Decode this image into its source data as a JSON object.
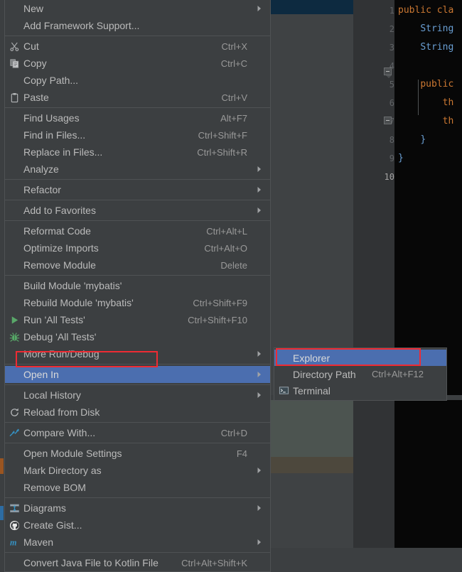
{
  "app": {
    "theme": "IntelliJ IDEA Darcula",
    "accent_highlight": "#4b6eaf",
    "annotation_color": "#ee2b33",
    "menu_bg": "#3c3f41",
    "menu_text": "#bbbbbb"
  },
  "editor": {
    "gutter_line_numbers": [
      "1",
      "2",
      "3",
      "4",
      "5",
      "6",
      "7",
      "8",
      "9",
      "10"
    ],
    "current_line": "10",
    "code_lines": [
      {
        "num": "1",
        "tokens": [
          {
            "t": "public cla",
            "c": "kw"
          }
        ]
      },
      {
        "num": "2",
        "tokens": [
          {
            "t": "    ",
            "c": "plain"
          },
          {
            "t": "String",
            "c": "type"
          }
        ]
      },
      {
        "num": "3",
        "tokens": [
          {
            "t": "    ",
            "c": "plain"
          },
          {
            "t": "String",
            "c": "type"
          }
        ]
      },
      {
        "num": "4",
        "tokens": []
      },
      {
        "num": "5",
        "tokens": [
          {
            "t": "    ",
            "c": "plain"
          },
          {
            "t": "public",
            "c": "kw"
          }
        ]
      },
      {
        "num": "6",
        "tokens": [
          {
            "t": "        ",
            "c": "plain"
          },
          {
            "t": "th",
            "c": "kw"
          }
        ]
      },
      {
        "num": "7",
        "tokens": [
          {
            "t": "        ",
            "c": "plain"
          },
          {
            "t": "th",
            "c": "kw"
          }
        ]
      },
      {
        "num": "8",
        "tokens": [
          {
            "t": "    ",
            "c": "plain"
          },
          {
            "t": "}",
            "c": "brace"
          }
        ]
      },
      {
        "num": "9",
        "tokens": [
          {
            "t": "}",
            "c": "brace"
          }
        ]
      },
      {
        "num": "10",
        "tokens": []
      }
    ]
  },
  "context_menu": {
    "name": "project-view-context-menu",
    "groups": [
      {
        "items": [
          {
            "label": "New",
            "shortcut": "",
            "icon": "",
            "submenu": true
          },
          {
            "label": "Add Framework Support...",
            "shortcut": "",
            "icon": "",
            "submenu": false
          }
        ]
      },
      {
        "items": [
          {
            "label": "Cut",
            "shortcut": "Ctrl+X",
            "icon": "scissors-icon",
            "submenu": false
          },
          {
            "label": "Copy",
            "shortcut": "Ctrl+C",
            "icon": "copy-icon",
            "submenu": false
          },
          {
            "label": "Copy Path...",
            "shortcut": "",
            "icon": "",
            "submenu": false
          },
          {
            "label": "Paste",
            "shortcut": "Ctrl+V",
            "icon": "clipboard-icon",
            "submenu": false
          }
        ]
      },
      {
        "items": [
          {
            "label": "Find Usages",
            "shortcut": "Alt+F7",
            "icon": "",
            "submenu": false
          },
          {
            "label": "Find in Files...",
            "shortcut": "Ctrl+Shift+F",
            "icon": "",
            "submenu": false
          },
          {
            "label": "Replace in Files...",
            "shortcut": "Ctrl+Shift+R",
            "icon": "",
            "submenu": false
          },
          {
            "label": "Analyze",
            "shortcut": "",
            "icon": "",
            "submenu": true
          }
        ]
      },
      {
        "items": [
          {
            "label": "Refactor",
            "shortcut": "",
            "icon": "",
            "submenu": true
          }
        ]
      },
      {
        "items": [
          {
            "label": "Add to Favorites",
            "shortcut": "",
            "icon": "",
            "submenu": true
          }
        ]
      },
      {
        "items": [
          {
            "label": "Reformat Code",
            "shortcut": "Ctrl+Alt+L",
            "icon": "",
            "submenu": false
          },
          {
            "label": "Optimize Imports",
            "shortcut": "Ctrl+Alt+O",
            "icon": "",
            "submenu": false
          },
          {
            "label": "Remove Module",
            "shortcut": "Delete",
            "icon": "",
            "submenu": false
          }
        ]
      },
      {
        "items": [
          {
            "label": "Build Module 'mybatis'",
            "shortcut": "",
            "icon": "",
            "submenu": false
          },
          {
            "label": "Rebuild Module 'mybatis'",
            "shortcut": "Ctrl+Shift+F9",
            "icon": "",
            "submenu": false
          },
          {
            "label": "Run 'All Tests'",
            "shortcut": "Ctrl+Shift+F10",
            "icon": "run-icon",
            "submenu": false
          },
          {
            "label": "Debug 'All Tests'",
            "shortcut": "",
            "icon": "debug-icon",
            "submenu": false
          },
          {
            "label": "More Run/Debug",
            "shortcut": "",
            "icon": "",
            "submenu": true
          }
        ]
      },
      {
        "items": [
          {
            "label": "Open In",
            "shortcut": "",
            "icon": "",
            "submenu": true,
            "highlighted": true
          }
        ]
      },
      {
        "items": [
          {
            "label": "Local History",
            "shortcut": "",
            "icon": "",
            "submenu": true
          },
          {
            "label": "Reload from Disk",
            "shortcut": "",
            "icon": "refresh-icon",
            "submenu": false
          }
        ]
      },
      {
        "items": [
          {
            "label": "Compare With...",
            "shortcut": "Ctrl+D",
            "icon": "compare-icon",
            "submenu": false
          }
        ]
      },
      {
        "items": [
          {
            "label": "Open Module Settings",
            "shortcut": "F4",
            "icon": "",
            "submenu": false
          },
          {
            "label": "Mark Directory as",
            "shortcut": "",
            "icon": "",
            "submenu": true
          },
          {
            "label": "Remove BOM",
            "shortcut": "",
            "icon": "",
            "submenu": false
          }
        ]
      },
      {
        "items": [
          {
            "label": "Diagrams",
            "shortcut": "",
            "icon": "diagram-icon",
            "submenu": true
          },
          {
            "label": "Create Gist...",
            "shortcut": "",
            "icon": "github-icon",
            "submenu": false
          },
          {
            "label": "Maven",
            "shortcut": "",
            "icon": "maven-icon",
            "submenu": true
          }
        ]
      },
      {
        "items": [
          {
            "label": "Convert Java File to Kotlin File",
            "shortcut": "Ctrl+Alt+Shift+K",
            "icon": "",
            "submenu": false
          }
        ]
      }
    ]
  },
  "submenu": {
    "name": "open-in-submenu",
    "items": [
      {
        "label": "Explorer",
        "shortcut": "",
        "icon": "",
        "submenu": false,
        "highlighted": true
      },
      {
        "label": "Directory Path",
        "shortcut": "Ctrl+Alt+F12",
        "icon": "",
        "submenu": false
      },
      {
        "label": "Terminal",
        "shortcut": "",
        "icon": "terminal-icon",
        "submenu": false
      }
    ]
  },
  "annotations": [
    {
      "name": "open-in-highlight-box",
      "target": "Open In"
    },
    {
      "name": "explorer-highlight-box",
      "target": "Explorer"
    }
  ]
}
